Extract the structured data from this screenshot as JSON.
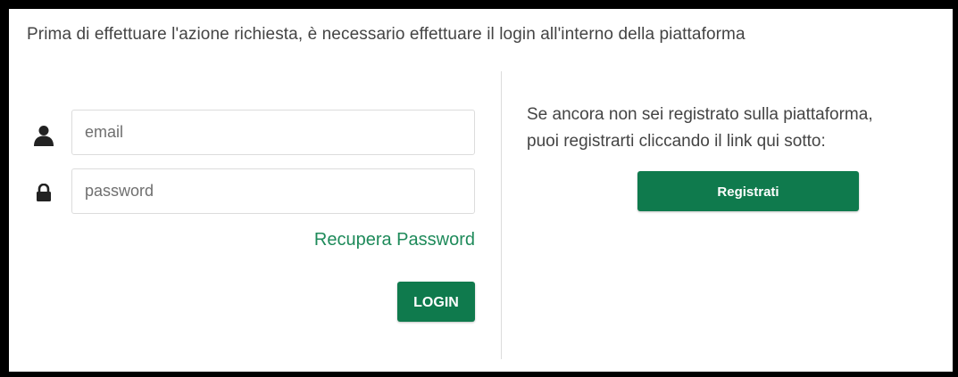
{
  "intro_text": "Prima di effettuare l'azione richiesta, è necessario effettuare il login all'interno della piattaforma",
  "login": {
    "email_placeholder": "email",
    "email_value": "",
    "password_placeholder": "password",
    "password_value": "",
    "recover_link": "Recupera Password",
    "login_button": "LOGIN",
    "user_icon": "user-icon",
    "lock_icon": "lock-icon"
  },
  "register": {
    "line1": "Se ancora non sei registrato sulla piattaforma,",
    "line2": "puoi registrarti cliccando il link qui sotto:",
    "button": "Registrati"
  },
  "colors": {
    "accent": "#0f7a4d",
    "link": "#1e8a5a",
    "text": "#444444"
  }
}
